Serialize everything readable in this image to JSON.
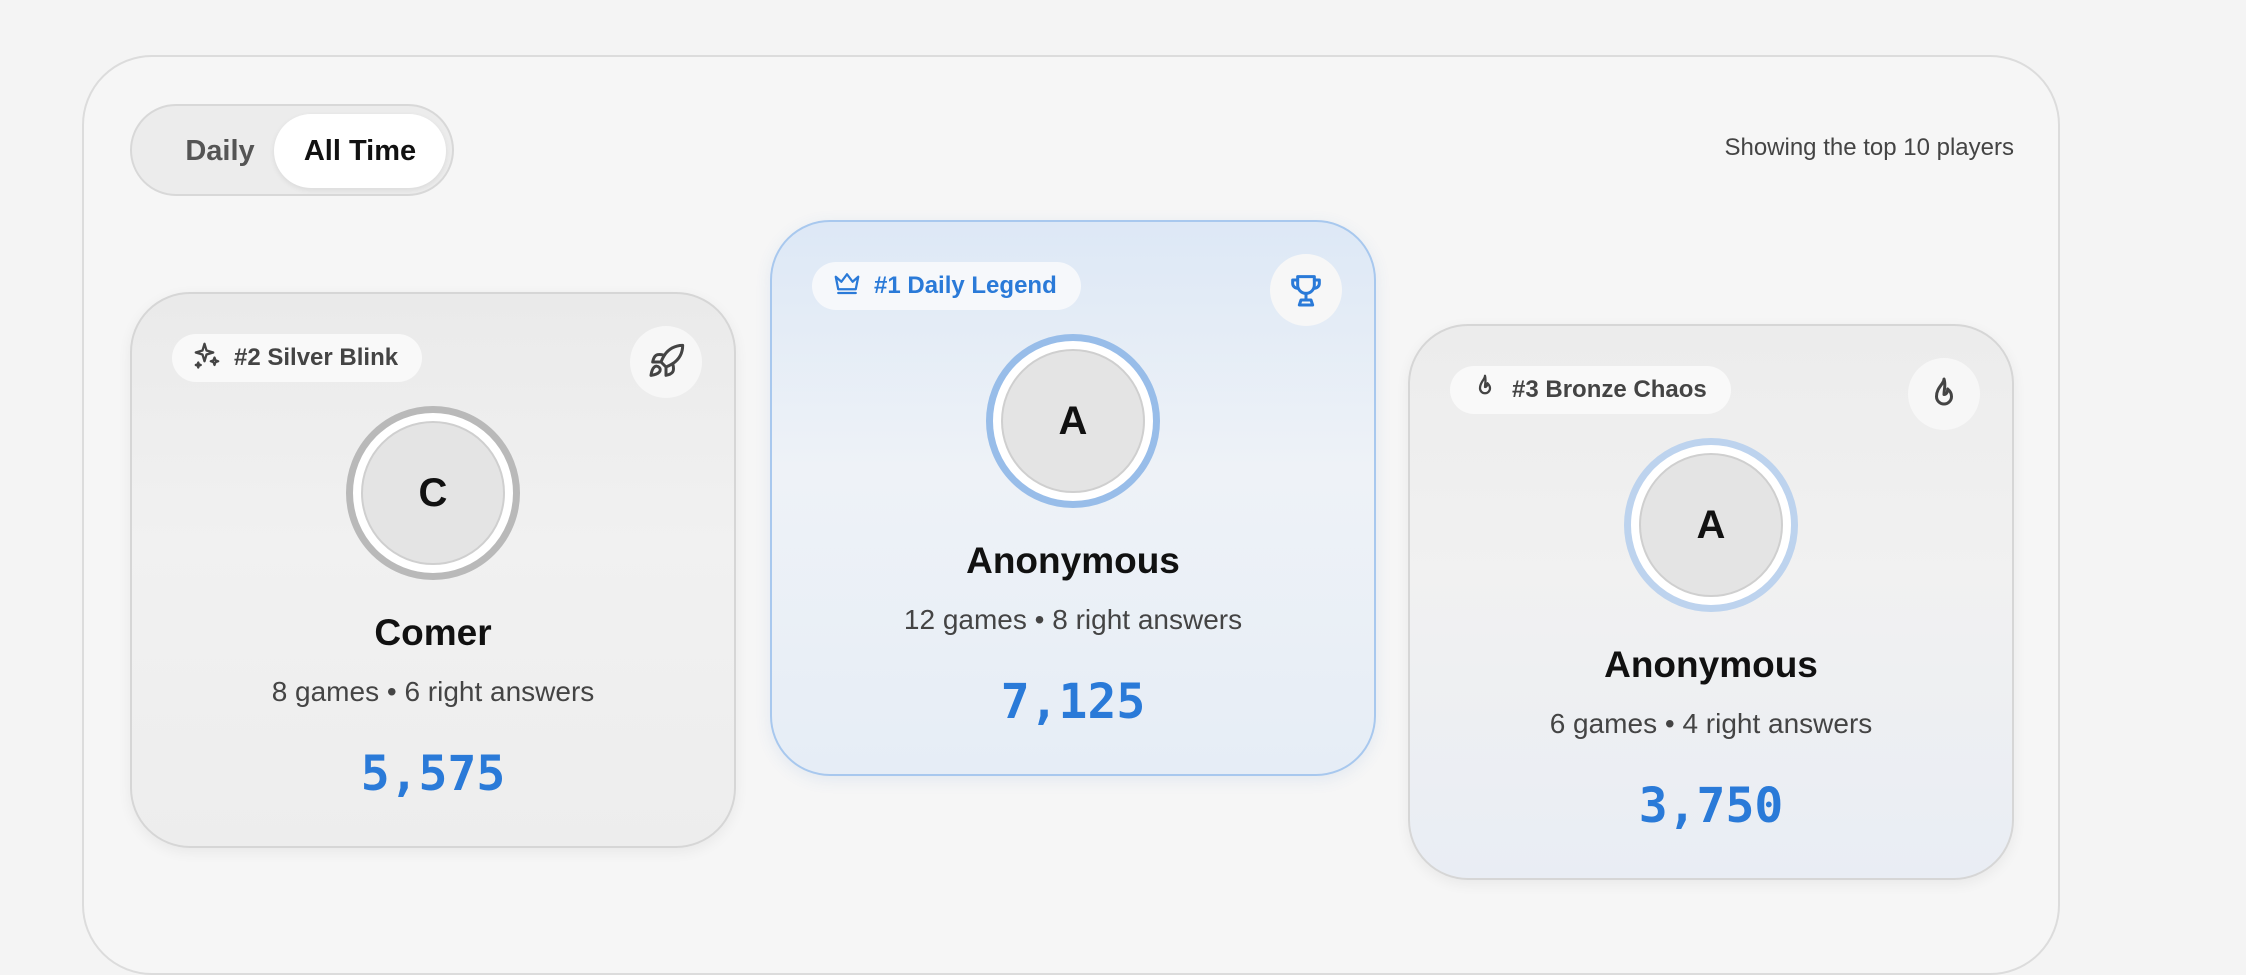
{
  "toggle": {
    "daily_label": "Daily",
    "alltime_label": "All Time",
    "selected": "All Time"
  },
  "showing_text": "Showing the top 10 players",
  "accent_color": "#2a7ad8",
  "cards": {
    "first": {
      "badge": "#1 Daily Legend",
      "badge_icon": "crown-icon",
      "corner_icon": "trophy-icon",
      "initial": "A",
      "name": "Anonymous",
      "stats": "12 games • 8 right answers",
      "score": "7,125"
    },
    "second": {
      "badge": "#2 Silver Blink",
      "badge_icon": "sparkles-icon",
      "corner_icon": "rocket-icon",
      "initial": "C",
      "name": "Comer",
      "stats": "8 games • 6 right answers",
      "score": "5,575"
    },
    "third": {
      "badge": "#3 Bronze Chaos",
      "badge_icon": "flame-icon",
      "corner_icon": "flame-icon",
      "initial": "A",
      "name": "Anonymous",
      "stats": "6 games • 4 right answers",
      "score": "3,750"
    }
  }
}
